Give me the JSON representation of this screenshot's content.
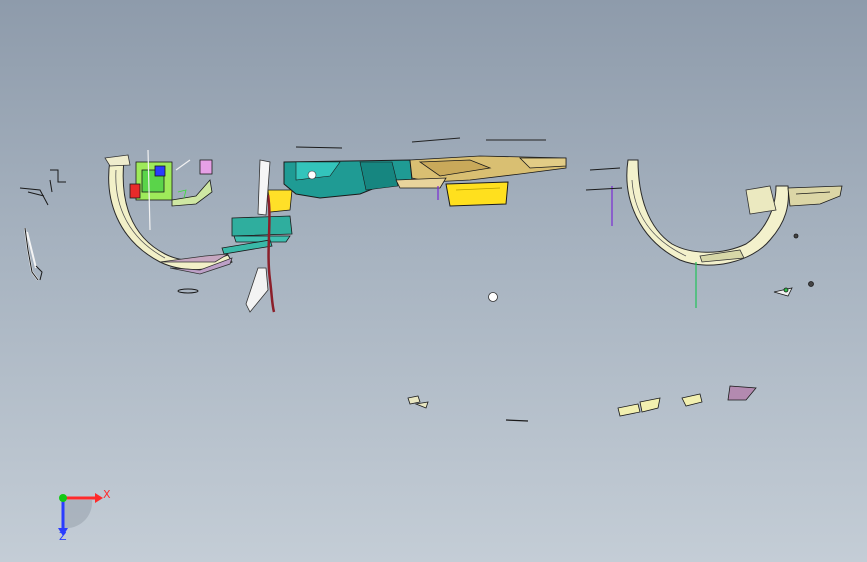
{
  "viewport": {
    "background_top": "#8e9bab",
    "background_bottom": "#c4cdd6"
  },
  "triad": {
    "x_label": "X",
    "z_label": "Z",
    "x_color": "#ff2a2a",
    "y_color": "#14c814",
    "z_color": "#2a3cff"
  },
  "icons": [
    "front-bumper-assembly-model",
    "coordinate-triad-icon"
  ]
}
